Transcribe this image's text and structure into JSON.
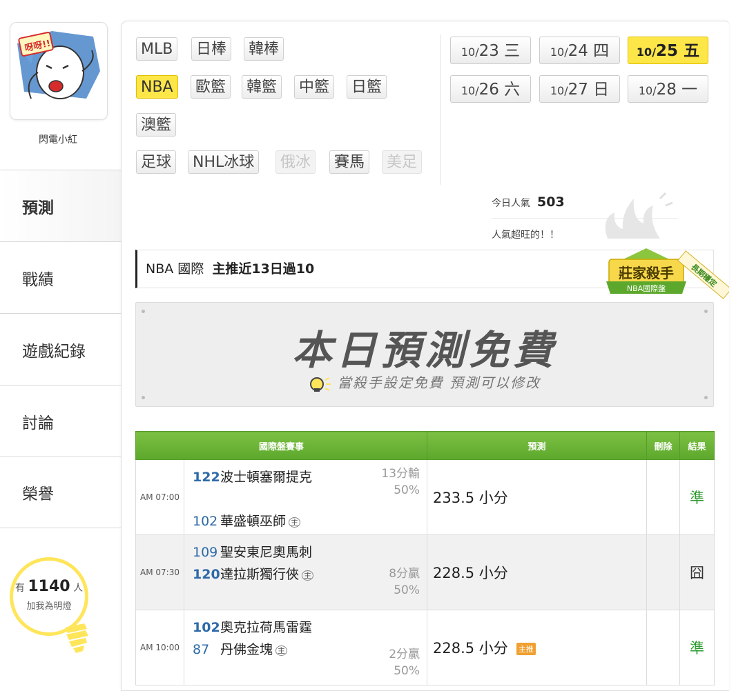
{
  "user": {
    "name": "閃電小紅",
    "avatar_text": "呀呀!!"
  },
  "nav": [
    {
      "label": "預測"
    },
    {
      "label": "戰績"
    },
    {
      "label": "遊戲紀錄"
    },
    {
      "label": "討論"
    },
    {
      "label": "榮譽"
    }
  ],
  "fans": {
    "prefix": "有",
    "count": "1140",
    "suffix": "人",
    "caption": "加我為明燈"
  },
  "leagues": {
    "row1": [
      "MLB",
      "日棒",
      "韓棒"
    ],
    "row2": [
      "NBA",
      "歐籃",
      "韓籃",
      "中籃",
      "日籃"
    ],
    "row3": [
      "澳籃"
    ],
    "row4": [
      "足球",
      "NHL冰球",
      "俄冰",
      "賽馬",
      "美足"
    ],
    "active": "NBA",
    "disabled": [
      "俄冰",
      "美足"
    ]
  },
  "dates": [
    {
      "md": "10/",
      "d": "23",
      "wd": "三"
    },
    {
      "md": "10/",
      "d": "24",
      "wd": "四"
    },
    {
      "md": "10/",
      "d": "25",
      "wd": "五"
    },
    {
      "md": "10/",
      "d": "26",
      "wd": "六"
    },
    {
      "md": "10/",
      "d": "27",
      "wd": "日"
    },
    {
      "md": "10/",
      "d": "28",
      "wd": "一"
    }
  ],
  "popularity": {
    "label": "今日人氣",
    "value": "503",
    "note": "人氣超旺的！！"
  },
  "title": {
    "league": "NBA",
    "market": "國際",
    "headline": "主推近13日過10"
  },
  "badge": {
    "main": "莊家殺手",
    "sub": "NBA國際盤",
    "ribbon": "長期穩定"
  },
  "banner": {
    "title": "本日預測免費",
    "subtitle": "當殺手設定免費 預測可以修改"
  },
  "table": {
    "headers": {
      "event": "國際盤賽事",
      "prediction": "預測",
      "delete": "刪除",
      "result": "結果"
    },
    "home_mark": "主",
    "main_pick_tag": "主推",
    "rows": [
      {
        "time": "AM 07:00",
        "away_score": "122",
        "away": "波士頓塞爾提克",
        "home_score": "102",
        "home": "華盛頓巫師",
        "spread": "13分輸",
        "pct": "50%",
        "pick": "233.5 小分",
        "main": false,
        "result": "準"
      },
      {
        "time": "AM 07:30",
        "away_score": "109",
        "away": "聖安東尼奧馬刺",
        "home_score": "120",
        "home": "達拉斯獨行俠",
        "spread": "8分贏",
        "pct": "50%",
        "pick": "228.5 小分",
        "main": false,
        "result": "囧"
      },
      {
        "time": "AM 10:00",
        "away_score": "102",
        "away": "奧克拉荷馬雷霆",
        "home_score": "87",
        "home": "丹佛金塊",
        "spread": "2分贏",
        "pct": "50%",
        "pick": "228.5 小分",
        "main": true,
        "result": "準"
      }
    ]
  },
  "colors": {
    "accent_yellow": "#fde648",
    "header_green": "#6cb43a",
    "score_blue": "#2d6aa8",
    "result_ok": "#2e9a2e"
  }
}
